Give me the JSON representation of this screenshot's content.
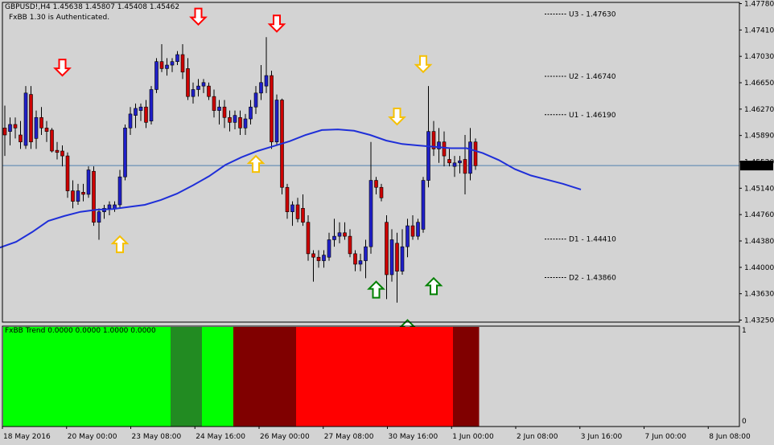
{
  "header": {
    "symbol_line": "GBPUSD!,H4  1.45638 1.45807 1.45408 1.45462",
    "status_line": "FxBB 1.30 is Authenticated."
  },
  "indicator": {
    "label": "FxBB Trend 0.0000 0.0000 1.0000 0.0000",
    "axis_top": "1",
    "axis_bottom": "0"
  },
  "colors": {
    "background": "#d3d3d3",
    "bull": "#1f1fc8",
    "bear": "#cc0000",
    "ma": "#1f2fd8",
    "level_line": "#5080b0",
    "up_yellow": "#f5c000",
    "down_red": "#ff0000",
    "up_green": "#008000",
    "trend_bright_green": "#00ff00",
    "trend_dark_green": "#228b22",
    "trend_maroon": "#800000",
    "trend_red": "#ff0000"
  },
  "chart_data": [
    {
      "type": "candlestick",
      "title": "GBPUSD!,H4",
      "ohlc_header": [
        "1.45638",
        "1.45807",
        "1.45408",
        "1.45462"
      ],
      "current_price": "1.45462",
      "y_ticks": [
        "1.47780",
        "1.47410",
        "1.47030",
        "1.46650",
        "1.46270",
        "1.45890",
        "1.45520",
        "1.45140",
        "1.44760",
        "1.44380",
        "1.44000",
        "1.43630",
        "1.43250"
      ],
      "x_ticks": [
        "18 May 2016",
        "20 May 00:00",
        "23 May 08:00",
        "24 May 16:00",
        "26 May 00:00",
        "27 May 08:00",
        "30 May 16:00",
        "1 Jun 00:00",
        "2 Jun 08:00",
        "3 Jun 16:00",
        "7 Jun 00:00",
        "8 Jun 08:00"
      ],
      "ylim": [
        1.4325,
        1.4778
      ],
      "candles": [
        [
          1.46,
          1.4632,
          1.456,
          1.459
        ],
        [
          1.4595,
          1.4615,
          1.4575,
          1.4605
        ],
        [
          1.4605,
          1.4615,
          1.4585,
          1.46
        ],
        [
          1.459,
          1.461,
          1.457,
          1.458
        ],
        [
          1.4575,
          1.466,
          1.457,
          1.465
        ],
        [
          1.4648,
          1.466,
          1.457,
          1.458
        ],
        [
          1.4585,
          1.4625,
          1.457,
          1.4615
        ],
        [
          1.4615,
          1.463,
          1.459,
          1.46
        ],
        [
          1.46,
          1.461,
          1.458,
          1.4595
        ],
        [
          1.4597,
          1.46,
          1.4565,
          1.4567
        ],
        [
          1.4568,
          1.458,
          1.4555,
          1.4565
        ],
        [
          1.4567,
          1.4575,
          1.4545,
          1.456
        ],
        [
          1.456,
          1.4565,
          1.45,
          1.451
        ],
        [
          1.451,
          1.4525,
          1.4485,
          1.4495
        ],
        [
          1.4495,
          1.452,
          1.449,
          1.451
        ],
        [
          1.4508,
          1.452,
          1.4495,
          1.4505
        ],
        [
          1.4505,
          1.4545,
          1.45,
          1.454
        ],
        [
          1.4538,
          1.4545,
          1.446,
          1.4465
        ],
        [
          1.4465,
          1.4485,
          1.444,
          1.448
        ],
        [
          1.448,
          1.449,
          1.447,
          1.4485
        ],
        [
          1.4485,
          1.4495,
          1.4475,
          1.449
        ],
        [
          1.4485,
          1.4495,
          1.448,
          1.449
        ],
        [
          1.449,
          1.454,
          1.4485,
          1.453
        ],
        [
          1.453,
          1.4605,
          1.4525,
          1.46
        ],
        [
          1.46,
          1.463,
          1.459,
          1.462
        ],
        [
          1.4618,
          1.4635,
          1.46,
          1.4628
        ],
        [
          1.4625,
          1.4635,
          1.461,
          1.463
        ],
        [
          1.463,
          1.464,
          1.46,
          1.4608
        ],
        [
          1.461,
          1.466,
          1.4605,
          1.4655
        ],
        [
          1.4655,
          1.47,
          1.465,
          1.4695
        ],
        [
          1.4695,
          1.472,
          1.468,
          1.4685
        ],
        [
          1.4685,
          1.47,
          1.4675,
          1.469
        ],
        [
          1.469,
          1.47,
          1.468,
          1.4695
        ],
        [
          1.4695,
          1.471,
          1.469,
          1.4705
        ],
        [
          1.4705,
          1.472,
          1.467,
          1.468
        ],
        [
          1.4685,
          1.47,
          1.464,
          1.4645
        ],
        [
          1.4645,
          1.4665,
          1.4635,
          1.4655
        ],
        [
          1.4655,
          1.467,
          1.4645,
          1.466
        ],
        [
          1.466,
          1.467,
          1.465,
          1.4665
        ],
        [
          1.466,
          1.4665,
          1.464,
          1.4645
        ],
        [
          1.4645,
          1.4655,
          1.4615,
          1.4625
        ],
        [
          1.4625,
          1.464,
          1.4605,
          1.463
        ],
        [
          1.463,
          1.464,
          1.46,
          1.4615
        ],
        [
          1.4615,
          1.4625,
          1.4595,
          1.4608
        ],
        [
          1.4608,
          1.4625,
          1.4598,
          1.4618
        ],
        [
          1.4615,
          1.4625,
          1.459,
          1.46
        ],
        [
          1.46,
          1.462,
          1.459,
          1.4613
        ],
        [
          1.4613,
          1.464,
          1.4605,
          1.463
        ],
        [
          1.463,
          1.466,
          1.462,
          1.465
        ],
        [
          1.465,
          1.469,
          1.464,
          1.4665
        ],
        [
          1.466,
          1.473,
          1.465,
          1.4675
        ],
        [
          1.4675,
          1.4682,
          1.457,
          1.458
        ],
        [
          1.458,
          1.4648,
          1.4575,
          1.464
        ],
        [
          1.464,
          1.4642,
          1.4505,
          1.4515
        ],
        [
          1.4515,
          1.452,
          1.447,
          1.448
        ],
        [
          1.448,
          1.4495,
          1.446,
          1.449
        ],
        [
          1.449,
          1.45,
          1.4465,
          1.447
        ],
        [
          1.4485,
          1.4505,
          1.446,
          1.4465
        ],
        [
          1.4465,
          1.4475,
          1.441,
          1.442
        ],
        [
          1.442,
          1.4425,
          1.438,
          1.4415
        ],
        [
          1.4415,
          1.4425,
          1.44,
          1.441
        ],
        [
          1.441,
          1.4425,
          1.44,
          1.4418
        ],
        [
          1.4415,
          1.445,
          1.441,
          1.444
        ],
        [
          1.444,
          1.447,
          1.443,
          1.4445
        ],
        [
          1.4445,
          1.4465,
          1.4435,
          1.445
        ],
        [
          1.445,
          1.4465,
          1.444,
          1.4445
        ],
        [
          1.4445,
          1.4455,
          1.4415,
          1.442
        ],
        [
          1.442,
          1.4425,
          1.4395,
          1.4405
        ],
        [
          1.4405,
          1.442,
          1.4395,
          1.441
        ],
        [
          1.441,
          1.444,
          1.4385,
          1.443
        ],
        [
          1.443,
          1.458,
          1.442,
          1.4525
        ],
        [
          1.4525,
          1.453,
          1.4505,
          1.4515
        ],
        [
          1.4515,
          1.452,
          1.4495,
          1.45
        ],
        [
          1.4465,
          1.4475,
          1.4355,
          1.439
        ],
        [
          1.439,
          1.4455,
          1.438,
          1.444
        ],
        [
          1.4435,
          1.445,
          1.435,
          1.4395
        ],
        [
          1.4395,
          1.4455,
          1.439,
          1.443
        ],
        [
          1.443,
          1.447,
          1.4415,
          1.446
        ],
        [
          1.446,
          1.4475,
          1.444,
          1.4445
        ],
        [
          1.4445,
          1.447,
          1.444,
          1.4465
        ],
        [
          1.4455,
          1.453,
          1.445,
          1.4525
        ],
        [
          1.4525,
          1.466,
          1.4515,
          1.4595
        ],
        [
          1.4595,
          1.461,
          1.456,
          1.457
        ],
        [
          1.457,
          1.46,
          1.455,
          1.458
        ],
        [
          1.458,
          1.4595,
          1.4545,
          1.456
        ],
        [
          1.4555,
          1.457,
          1.4545,
          1.455
        ],
        [
          1.4545,
          1.456,
          1.453,
          1.455
        ],
        [
          1.455,
          1.456,
          1.4535,
          1.4553
        ],
        [
          1.4555,
          1.459,
          1.4505,
          1.4535
        ],
        [
          1.4535,
          1.46,
          1.4525,
          1.458
        ],
        [
          1.458,
          1.4585,
          1.454,
          1.4546
        ]
      ],
      "moving_average": [
        [
          -2,
          1.4428
        ],
        [
          20,
          1.4437
        ],
        [
          40,
          1.4451
        ],
        [
          60,
          1.4467
        ],
        [
          80,
          1.4474
        ],
        [
          100,
          1.448
        ],
        [
          120,
          1.4483
        ],
        [
          140,
          1.4484
        ],
        [
          160,
          1.4487
        ],
        [
          180,
          1.449
        ],
        [
          200,
          1.4497
        ],
        [
          220,
          1.4506
        ],
        [
          240,
          1.4518
        ],
        [
          260,
          1.4531
        ],
        [
          280,
          1.4547
        ],
        [
          300,
          1.4558
        ],
        [
          320,
          1.4567
        ],
        [
          340,
          1.4574
        ],
        [
          360,
          1.4581
        ],
        [
          380,
          1.459
        ],
        [
          400,
          1.4597
        ],
        [
          420,
          1.4598
        ],
        [
          440,
          1.4596
        ],
        [
          460,
          1.459
        ],
        [
          480,
          1.4582
        ],
        [
          500,
          1.4577
        ],
        [
          520,
          1.4575
        ],
        [
          540,
          1.4573
        ],
        [
          560,
          1.4571
        ],
        [
          580,
          1.4571
        ],
        [
          600,
          1.4564
        ],
        [
          620,
          1.4554
        ],
        [
          640,
          1.4541
        ],
        [
          660,
          1.4532
        ],
        [
          680,
          1.4526
        ],
        [
          700,
          1.452
        ],
        [
          722,
          1.4512
        ]
      ],
      "levels": [
        {
          "label": "U3 - 1.47630",
          "value": 1.4763
        },
        {
          "label": "U2 - 1.46740",
          "value": 1.4674
        },
        {
          "label": "U1 - 1.46190",
          "value": 1.4619
        },
        {
          "label": "D1 - 1.44410",
          "value": 1.4441
        },
        {
          "label": "D2 - 1.43860",
          "value": 1.4386
        }
      ],
      "signals": [
        {
          "kind": "down",
          "color": "red",
          "idx": 11,
          "price": 1.4675
        },
        {
          "kind": "down",
          "color": "red",
          "idx": 37,
          "price": 1.4748
        },
        {
          "kind": "down",
          "color": "red",
          "idx": 52,
          "price": 1.4738
        },
        {
          "kind": "up",
          "color": "yellow",
          "idx": 22,
          "price": 1.4445
        },
        {
          "kind": "up",
          "color": "yellow",
          "idx": 48,
          "price": 1.456
        },
        {
          "kind": "down",
          "color": "yellow",
          "idx": 75,
          "price": 1.4605
        },
        {
          "kind": "down",
          "color": "yellow",
          "idx": 80,
          "price": 1.468
        },
        {
          "kind": "up",
          "color": "green",
          "idx": 71,
          "price": 1.438
        },
        {
          "kind": "up",
          "color": "green",
          "idx": 77,
          "price": 1.4325
        },
        {
          "kind": "up",
          "color": "green",
          "idx": 82,
          "price": 1.4385
        }
      ]
    },
    {
      "type": "area",
      "title": "FxBB Trend",
      "ylim": [
        0,
        1
      ],
      "segments": [
        {
          "from": 0,
          "to": 31,
          "color": "#00ff00"
        },
        {
          "from": 32,
          "to": 37,
          "color": "#228b22"
        },
        {
          "from": 38,
          "to": 43,
          "color": "#00ff00"
        },
        {
          "from": 44,
          "to": 55,
          "color": "#800000"
        },
        {
          "from": 56,
          "to": 85,
          "color": "#ff0000"
        },
        {
          "from": 86,
          "to": 90,
          "color": "#800000"
        }
      ]
    }
  ]
}
